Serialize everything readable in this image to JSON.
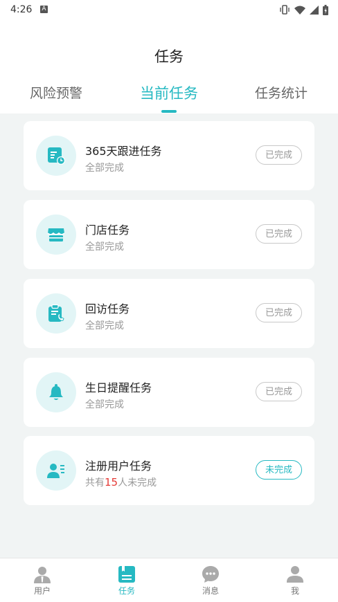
{
  "status_bar": {
    "time": "4:26",
    "notification_letter": "A"
  },
  "header": {
    "title": "任务"
  },
  "tabs": [
    {
      "label": "风险预警",
      "active": false
    },
    {
      "label": "当前任务",
      "active": true
    },
    {
      "label": "任务统计",
      "active": false
    }
  ],
  "tasks": [
    {
      "icon": "task-schedule-icon",
      "name": "365天跟进任务",
      "subtitle": "全部完成",
      "status": "已完成"
    },
    {
      "icon": "store-icon",
      "name": "门店任务",
      "subtitle": "全部完成",
      "status": "已完成"
    },
    {
      "icon": "clipboard-phone-icon",
      "name": "回访任务",
      "subtitle": "全部完成",
      "status": "已完成"
    },
    {
      "icon": "bell-icon",
      "name": "生日提醒任务",
      "subtitle": "全部完成",
      "status": "已完成"
    },
    {
      "icon": "user-card-icon",
      "name": "注册用户任务",
      "subtitle_prefix": "共有",
      "subtitle_count": "15",
      "subtitle_suffix": "人未完成",
      "status": "未完成"
    }
  ],
  "bottom_nav": [
    {
      "label": "用户",
      "icon": "user-icon",
      "active": false
    },
    {
      "label": "任务",
      "icon": "task-icon",
      "active": true
    },
    {
      "label": "消息",
      "icon": "message-icon",
      "active": false
    },
    {
      "label": "我",
      "icon": "profile-icon",
      "active": false
    }
  ],
  "colors": {
    "accent": "#26b9c2",
    "highlight": "#e53935",
    "background": "#f1f4f4"
  }
}
